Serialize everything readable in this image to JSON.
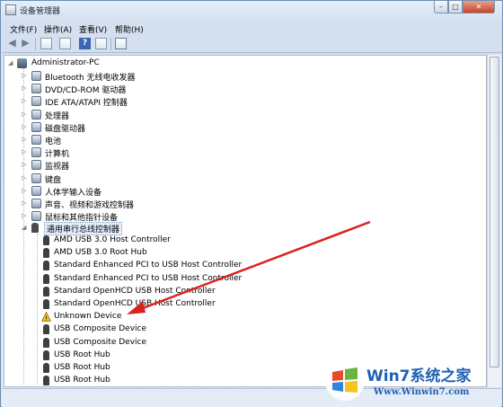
{
  "window": {
    "title": "设备管理器"
  },
  "menu": [
    {
      "label": "文件(F)"
    },
    {
      "label": "操作(A)"
    },
    {
      "label": "查看(V)"
    },
    {
      "label": "帮助(H)"
    }
  ],
  "toolbar": {
    "help_glyph": "?"
  },
  "tree": {
    "root": "Administrator-PC",
    "categories": [
      {
        "label": "Bluetooth 无线电收发器",
        "icon": "bluetooth-icon"
      },
      {
        "label": "DVD/CD-ROM 驱动器",
        "icon": "disc-drive-icon"
      },
      {
        "label": "IDE ATA/ATAPI 控制器",
        "icon": "ide-controller-icon"
      },
      {
        "label": "处理器",
        "icon": "processor-icon"
      },
      {
        "label": "磁盘驱动器",
        "icon": "disk-drive-icon"
      },
      {
        "label": "电池",
        "icon": "battery-icon"
      },
      {
        "label": "计算机",
        "icon": "computer-icon"
      },
      {
        "label": "监视器",
        "icon": "monitor-icon"
      },
      {
        "label": "键盘",
        "icon": "keyboard-icon"
      },
      {
        "label": "人体学输入设备",
        "icon": "hid-icon"
      },
      {
        "label": "声音、视频和游戏控制器",
        "icon": "sound-icon"
      },
      {
        "label": "鼠标和其他指针设备",
        "icon": "mouse-icon"
      }
    ],
    "usb_category": "通用串行总线控制器",
    "usb_devices": [
      {
        "label": "AMD USB 3.0 Host Controller",
        "icon": "usb-plug-icon"
      },
      {
        "label": "AMD USB 3.0 Root Hub",
        "icon": "usb-plug-icon"
      },
      {
        "label": "Standard Enhanced PCI to USB Host Controller",
        "icon": "usb-plug-icon"
      },
      {
        "label": "Standard Enhanced PCI to USB Host Controller",
        "icon": "usb-plug-icon"
      },
      {
        "label": "Standard OpenHCD USB Host Controller",
        "icon": "usb-plug-icon"
      },
      {
        "label": "Standard OpenHCD USB Host Controller",
        "icon": "usb-plug-icon"
      },
      {
        "label": "Unknown Device",
        "icon": "warning-icon"
      },
      {
        "label": "USB Composite Device",
        "icon": "usb-plug-icon"
      },
      {
        "label": "USB Composite Device",
        "icon": "usb-plug-icon"
      },
      {
        "label": "USB Root Hub",
        "icon": "usb-plug-icon"
      },
      {
        "label": "USB Root Hub",
        "icon": "usb-plug-icon"
      },
      {
        "label": "USB Root Hub",
        "icon": "usb-plug-icon"
      }
    ]
  },
  "watermark": {
    "brand": "Win7系统之家",
    "url": "Www.Winwin7.com"
  },
  "colors": {
    "arrow": "#d8231f",
    "warning": "#f2c21b",
    "brand": "#1f5fb4"
  }
}
